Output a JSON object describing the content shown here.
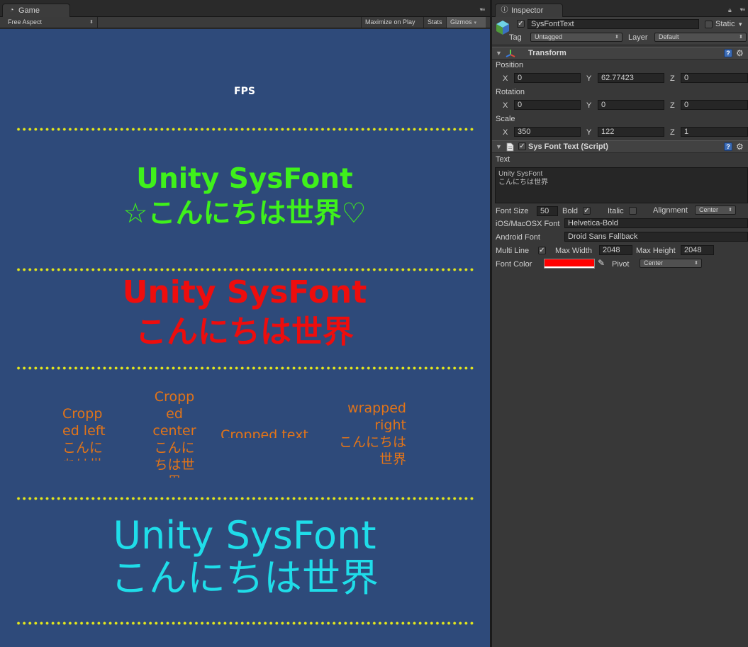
{
  "game": {
    "tab_label": "Game",
    "aspect": "Free Aspect",
    "buttons": {
      "maximize": "Maximize on Play",
      "stats": "Stats",
      "gizmos": "Gizmos"
    },
    "view": {
      "fps": "FPS",
      "green": {
        "line1": "Unity SysFont",
        "line2": "☆こんにちは世界♡",
        "color": "#3ff11b"
      },
      "red": {
        "line1": "Unity SysFont",
        "line2": "こんにちは世界",
        "color": "#ee0d0d"
      },
      "orange": {
        "color": "#e27418",
        "crop_left": "Cropp\ned left\nこんに\nちは世",
        "crop_center": "Cropp\ned\ncenter\nこんに\nちは世\n界",
        "crop_text": "Cropped text",
        "wrapped_right": "wrapped\nright\nこんにちは\n世界"
      },
      "cyan": {
        "line1": "Unity SysFont",
        "line2": "こんにちは世界",
        "color": "#1fdde9"
      },
      "bg_color": "#2e4a7a",
      "dot_color": "#e3e61c"
    }
  },
  "inspector": {
    "tab_label": "Inspector",
    "object": {
      "name": "SysFontText",
      "static_label": "Static",
      "tag_label": "Tag",
      "tag_value": "Untagged",
      "layer_label": "Layer",
      "layer_value": "Default"
    },
    "transform": {
      "title": "Transform",
      "position_label": "Position",
      "rotation_label": "Rotation",
      "scale_label": "Scale",
      "position": {
        "x": "0",
        "y": "62.77423",
        "z": "0"
      },
      "rotation": {
        "x": "0",
        "y": "0",
        "z": "0"
      },
      "scale": {
        "x": "350",
        "y": "122",
        "z": "1"
      }
    },
    "script": {
      "title": "Sys Font Text (Script)",
      "text_label": "Text",
      "text_value": "Unity SysFont\nこんにちは世界",
      "font_size_label": "Font Size",
      "font_size": "50",
      "bold_label": "Bold",
      "italic_label": "Italic",
      "alignment_label": "Alignment",
      "alignment_value": "Center",
      "ios_font_label": "iOS/MacOSX Font",
      "ios_font": "Helvetica-Bold",
      "android_font_label": "Android Font",
      "android_font": "Droid Sans Fallback",
      "multiline_label": "Multi Line",
      "max_width_label": "Max Width",
      "max_width": "2048",
      "max_height_label": "Max Height",
      "max_height": "2048",
      "font_color_label": "Font Color",
      "font_color": "#ff0000",
      "pivot_label": "Pivot",
      "pivot_value": "Center"
    },
    "axes": {
      "x": "X",
      "y": "Y",
      "z": "Z"
    }
  }
}
